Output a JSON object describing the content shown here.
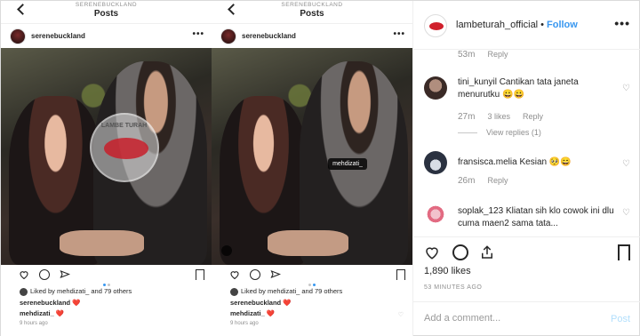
{
  "left": {
    "shots": [
      {
        "top_username": "SERENEBUCKLAND",
        "top_title": "Posts",
        "post_username": "serenebuckland",
        "liked_by": "Liked by mehdizati_ and 79 others",
        "caption_user": "serenebuckland",
        "caption_heart": "❤️",
        "comment_user": "mehdizati_",
        "comment_heart": "❤️",
        "time_ago": "9 hours ago",
        "watermark": "LAMBE TURAH"
      },
      {
        "top_username": "SERENEBUCKLAND",
        "top_title": "Posts",
        "post_username": "serenebuckland",
        "tag_label": "mehdizati_",
        "liked_by": "Liked by mehdizati_ and 79 others",
        "caption_user": "serenebuckland",
        "caption_heart": "❤️",
        "comment_user": "mehdizati_",
        "comment_heart": "❤️",
        "time_ago": "9 hours ago"
      }
    ]
  },
  "panel": {
    "header": {
      "account": "lambeturah_official",
      "separator": "•",
      "follow_label": "Follow",
      "more": "•••"
    },
    "comments": [
      {
        "time": "53m",
        "reply": "Reply"
      },
      {
        "user": "tini_kunyil",
        "text": "Cantikan tata janeta menurutku 😀😀",
        "time": "27m",
        "likes": "3 likes",
        "reply": "Reply",
        "view_replies": "View replies (1)"
      },
      {
        "user": "fransisca.melia",
        "text": "Kesian 🥺😄",
        "time": "26m",
        "reply": "Reply"
      },
      {
        "user": "soplak_123",
        "text": "Kliatan sih klo cowok ini dlu cuma maen2 sama tata..."
      }
    ],
    "likes": "1,890 likes",
    "posted_ago": "53 MINUTES AGO",
    "add_comment_placeholder": "Add a comment...",
    "post_label": "Post"
  },
  "colors": {
    "accent_blue": "#3897f0",
    "heart_red": "#ed4956",
    "muted": "#8e8e8e"
  }
}
